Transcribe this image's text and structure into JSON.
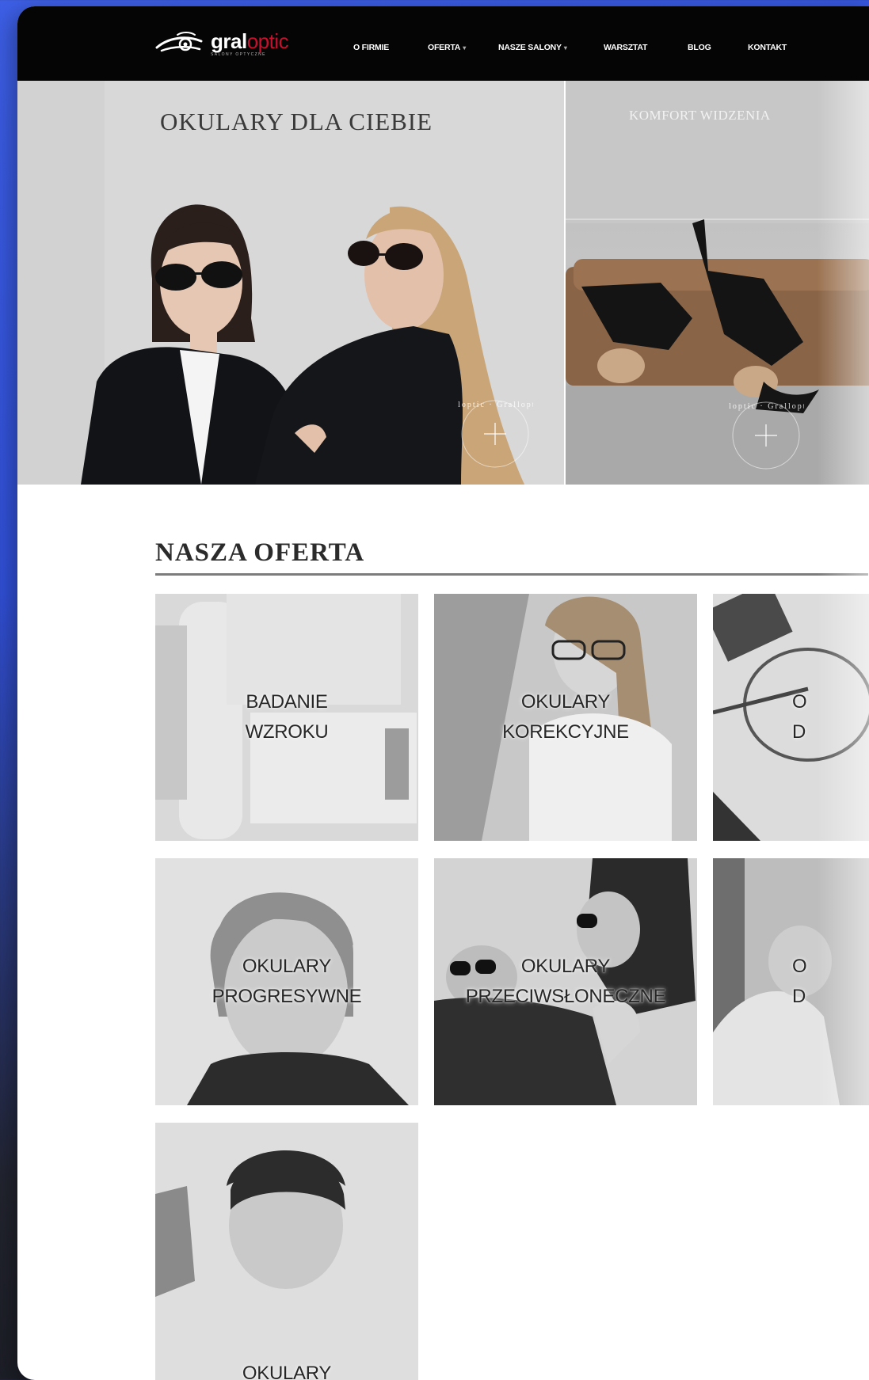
{
  "brand": {
    "name_main": "gral",
    "name_accent": "optic",
    "tagline": "SALONY OPTYCZNE",
    "accent_color": "#c8102e"
  },
  "nav": {
    "items": [
      {
        "label": "O FIRMIE",
        "dropdown": false
      },
      {
        "label": "OFERTA",
        "dropdown": true
      },
      {
        "label": "NASZE SALONY",
        "dropdown": true
      },
      {
        "label": "WARSZTAT",
        "dropdown": false
      },
      {
        "label": "BLOG",
        "dropdown": false
      },
      {
        "label": "KONTAKT",
        "dropdown": false
      }
    ],
    "caret": "▾"
  },
  "hero": {
    "left_title": "OKULARY DLA CIEBIE",
    "right_title": "KOMFORT WIDZENIA",
    "seal_text": "Gralloptic · Gralloptic · "
  },
  "offer": {
    "title": "NASZA OFERTA",
    "tiles": [
      {
        "line1": "BADANIE",
        "line2": "WZROKU"
      },
      {
        "line1": "OKULARY",
        "line2": "KOREKCYJNE"
      },
      {
        "line1": "O",
        "line2": "D"
      },
      {
        "line1": "OKULARY",
        "line2": "PROGRESYWNE"
      },
      {
        "line1": "OKULARY",
        "line2": "PRZECIWSŁONECZNE"
      },
      {
        "line1": "O",
        "line2": "D"
      },
      {
        "line1": "OKULARY",
        "line2": ""
      }
    ]
  },
  "colors": {
    "navbar": "#050505",
    "frame_blue": "#3d5fe6",
    "tile_gray": "#d4d4d4"
  }
}
